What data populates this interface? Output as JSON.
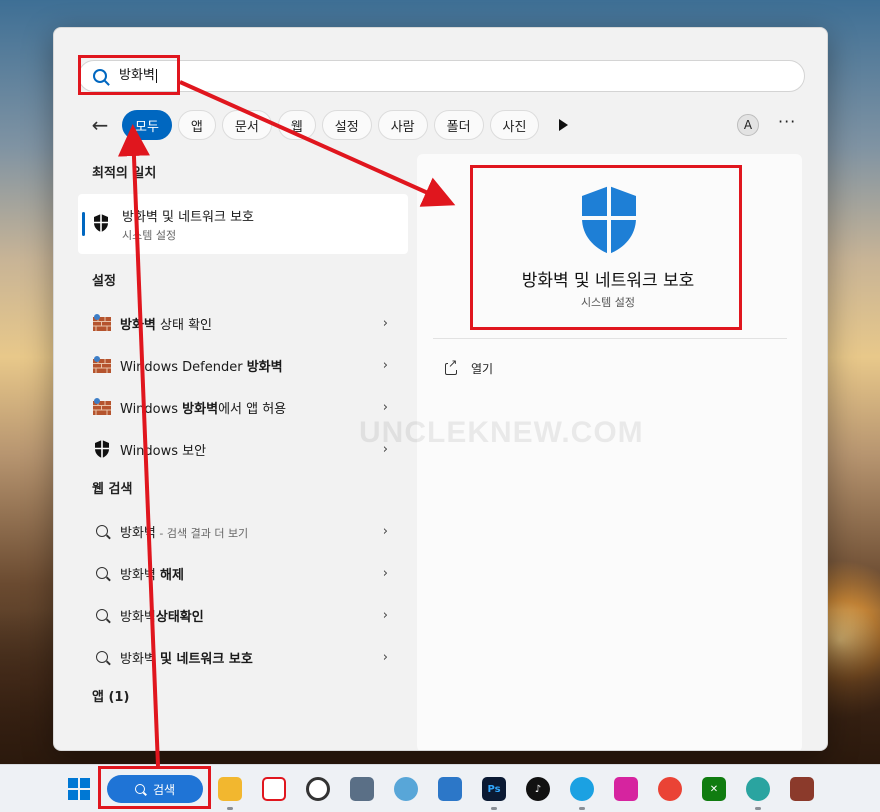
{
  "search": {
    "query": "방화벽"
  },
  "filters": {
    "back": "←",
    "chips": [
      "모두",
      "앱",
      "문서",
      "웹",
      "설정",
      "사람",
      "폴더",
      "사진"
    ],
    "account_initial": "A",
    "more": "···"
  },
  "best_match": {
    "heading": "최적의 일치",
    "title": "방화벽 및 네트워크 보호",
    "subtitle": "시스템 설정"
  },
  "settings": {
    "heading": "설정",
    "items": [
      {
        "bold": "방화벽",
        "rest": " 상태 확인"
      },
      {
        "pre": "Windows Defender ",
        "bold": "방화벽"
      },
      {
        "pre": "Windows ",
        "bold": "방화벽",
        "rest": "에서 앱 허용"
      },
      {
        "pre": "Windows 보안"
      }
    ]
  },
  "web": {
    "heading": "웹 검색",
    "items": [
      {
        "pre": "방화벽",
        "sub": " - 검색 결과 더 보기"
      },
      {
        "pre": "방화벽 ",
        "bold": "해제"
      },
      {
        "pre": "방화벽",
        "bold": "상태확인"
      },
      {
        "pre": "방화벽 ",
        "bold": "및 네트워크 보호"
      }
    ]
  },
  "apps": {
    "heading": "앱 (1)"
  },
  "detail": {
    "title": "방화벽 및 네트워크 보호",
    "subtitle": "시스템 설정",
    "open_label": "열기"
  },
  "watermark": "UNCLEKNEW.COM",
  "taskbar": {
    "search_label": "검색",
    "apps": [
      "file-explorer",
      "task-view",
      "creative-cloud",
      "calculator",
      "paint",
      "notepad",
      "photoshop",
      "tiktok",
      "edge",
      "instagram",
      "chrome",
      "xbox",
      "copilot",
      "winrar"
    ]
  },
  "colors": {
    "accent": "#0067c0",
    "annotation": "#e0161e",
    "shield": "#1e7fd6"
  }
}
